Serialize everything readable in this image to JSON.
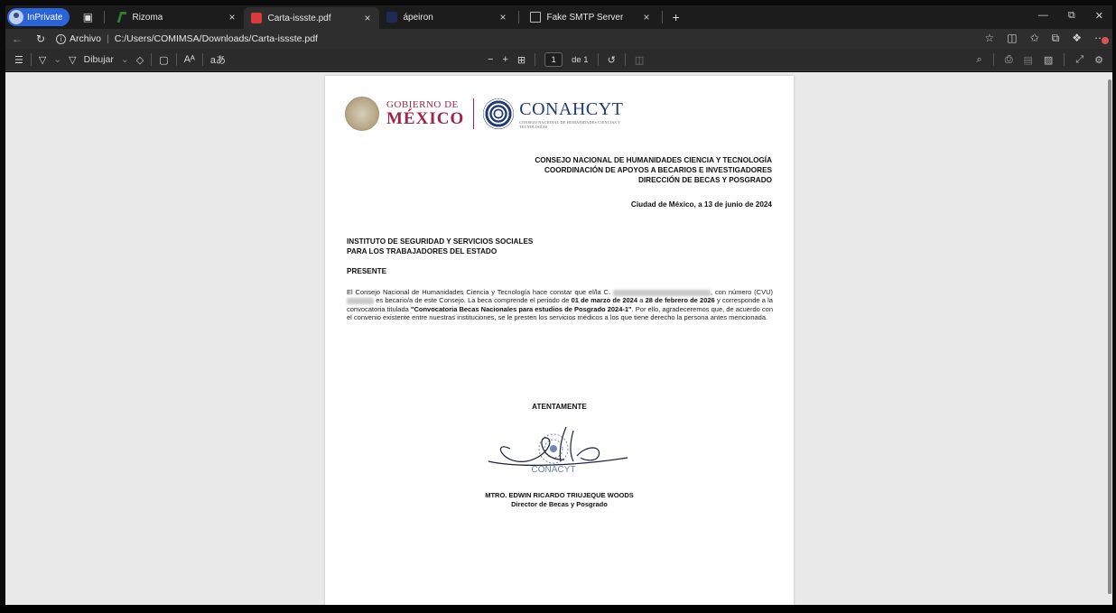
{
  "browser": {
    "profile_label": "InPrivate",
    "tabs": [
      {
        "title": "Rizoma",
        "active": false
      },
      {
        "title": "Carta-issste.pdf",
        "active": true
      },
      {
        "title": "ápeiron",
        "active": false
      },
      {
        "title": "Fake SMTP Server",
        "active": false
      }
    ],
    "address": {
      "prefix": "Archivo",
      "path": "C:/Users/COMIMSA/Downloads/Carta-issste.pdf"
    }
  },
  "pdf_toolbar": {
    "draw_label": "Dibujar",
    "page_current": "1",
    "page_total": "de 1",
    "zoom_out": "−",
    "zoom_in": "+"
  },
  "letter": {
    "gob_line1": "GOBIERNO DE",
    "gob_line2": "MÉXICO",
    "conahcyt_name": "CONAHCYT",
    "conahcyt_sub": "CONSEJO NACIONAL DE HUMANIDADES CIENCIAS Y TECNOLOGÍAS",
    "header": [
      "CONSEJO NACIONAL DE HUMANIDADES CIENCIA Y TECNOLOGÍA",
      "COORDINACIÓN DE APOYOS A BECARIOS E INVESTIGADORES",
      "DIRECCIÓN DE BECAS Y POSGRADO"
    ],
    "date": "Ciudad de México, a 13 de junio de 2024",
    "addressee": [
      "INSTITUTO DE SEGURIDAD Y SERVICIOS SOCIALES",
      "PARA LOS TRABAJADORES DEL ESTADO"
    ],
    "greeting": "PRESENTE",
    "body": {
      "p1": "El Consejo Nacional de Humanidades Ciencia y Tecnología hace constar que el/la C.",
      "p2": ", con número (CVU)",
      "p3": "es becario/a de este Consejo. La beca comprende el periodo de",
      "start": "01 de marzo de 2024",
      "p4": "a",
      "end": "28 de febrero de 2026",
      "p5": "y corresponde a la convocatoria titulada",
      "call": "\"Convocatoria Becas Nacionales para estudios de Posgrado 2024-1\"",
      "p6": ". Por ello, agradeceremos que, de acuerdo con el convenio existente entre nuestras instituciones, se le presten los servicios médicos a los que tiene derecho la persona antes mencionada."
    },
    "closing": "ATENTAMENTE",
    "stamp_text": "CONACYT",
    "signer_name": "MTRO. EDWIN RICARDO TRIUJEQUE WOODS",
    "signer_title": "Director de Becas y Posgrado"
  }
}
